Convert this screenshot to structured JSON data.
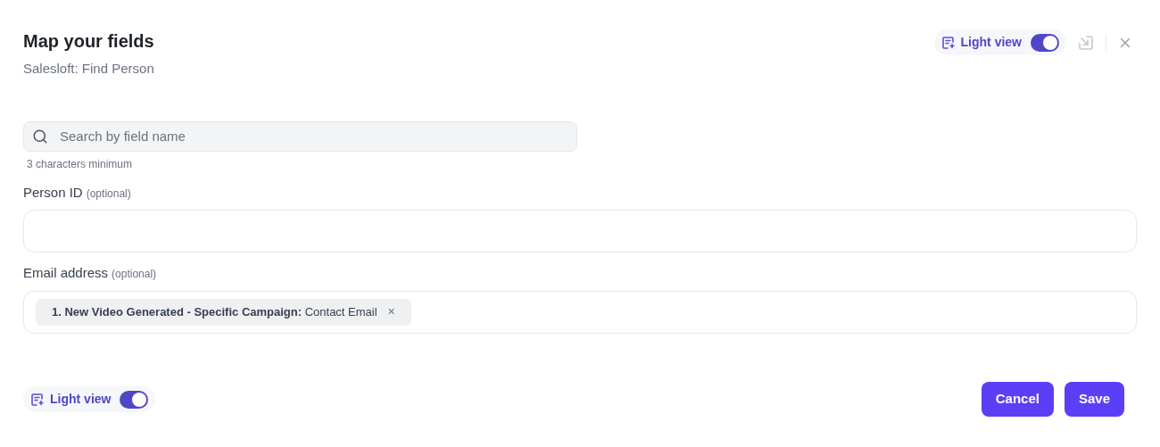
{
  "header": {
    "title": "Map your fields",
    "subtitle": "Salesloft: Find Person",
    "light_view": {
      "label": "Light view",
      "on": true
    }
  },
  "search": {
    "placeholder": "Search by field name",
    "hint": "3 characters minimum"
  },
  "fields": [
    {
      "label": "Person ID",
      "optional": "(optional)"
    },
    {
      "label": "Email address",
      "optional": "(optional)",
      "chips": [
        {
          "text": "**1. New Video Generated - Specific Campaign:** Contact Email",
          "remove": "×"
        }
      ]
    }
  ],
  "footer": {
    "light_view": {
      "label": "Light view",
      "on": true
    },
    "buttons": [
      "Cancel",
      "Save"
    ]
  }
}
